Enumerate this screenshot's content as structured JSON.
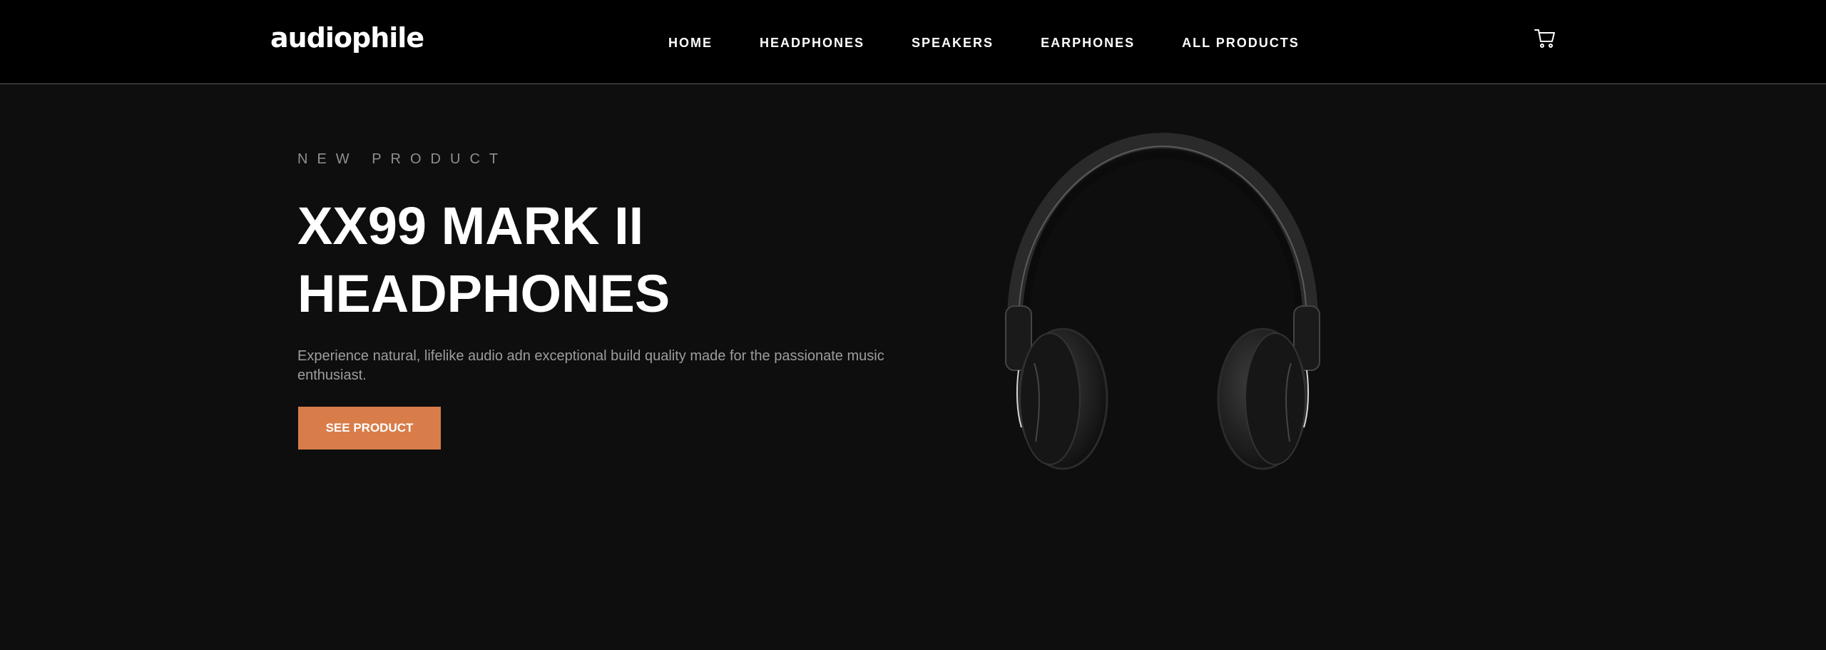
{
  "header": {
    "logo": "audiophile",
    "nav": [
      {
        "label": "HOME"
      },
      {
        "label": "HEADPHONES"
      },
      {
        "label": "SPEAKERS"
      },
      {
        "label": "EARPHONES"
      },
      {
        "label": "ALL PRODUCTS"
      }
    ],
    "cart_icon": "cart-icon"
  },
  "hero": {
    "overline": "NEW PRODUCT",
    "title_line1": "XX99 MARK II",
    "title_line2": "HEADPHONES",
    "description": "Experience natural, lifelike audio adn exceptional build quality made for the passionate music enthusiast.",
    "cta_label": "SEE PRODUCT",
    "image": "headphones-image"
  },
  "colors": {
    "accent": "#d87d4a",
    "header_bg": "#000000",
    "hero_bg": "#0e0e0e",
    "text_primary": "#ffffff",
    "text_muted": "#9d9d9d"
  }
}
